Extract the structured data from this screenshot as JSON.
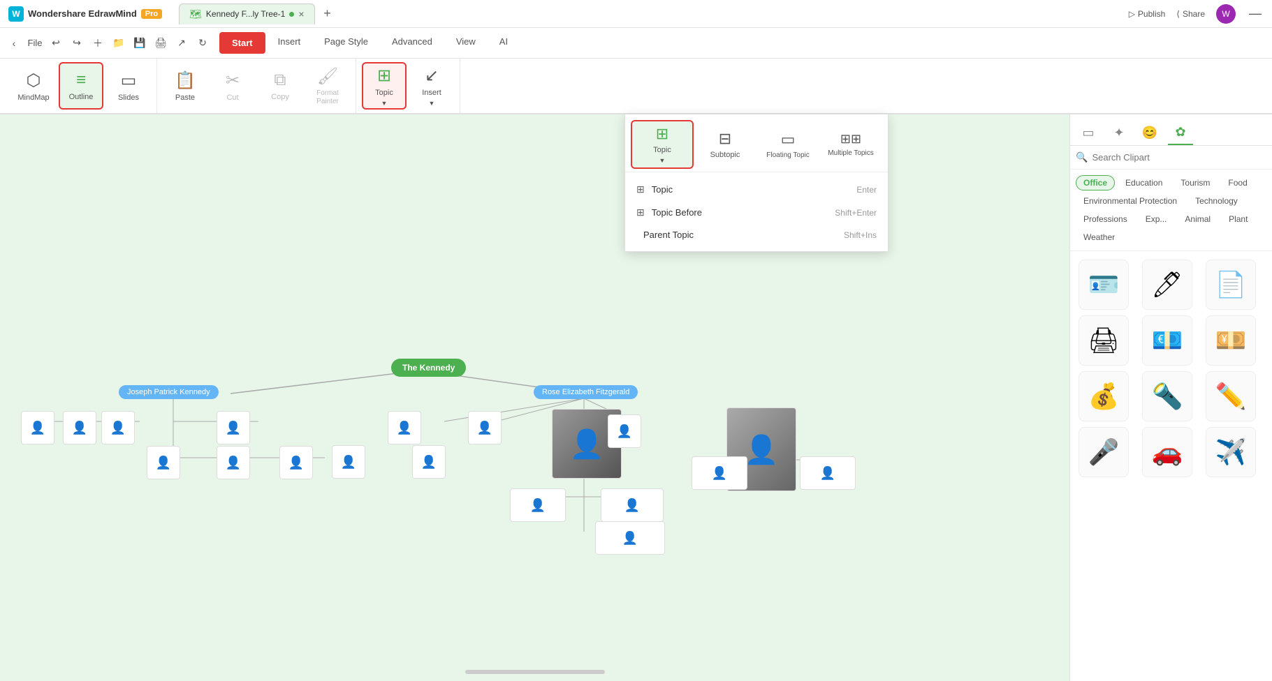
{
  "app": {
    "name": "Wondershare EdrawMind",
    "pro_label": "Pro",
    "tab_title": "Kennedy F...ly Tree-1",
    "avatar_initials": "W"
  },
  "title_bar": {
    "publish_label": "Publish",
    "share_label": "Share"
  },
  "nav": {
    "file_label": "File",
    "back_tooltip": "Back",
    "forward_tooltip": "Forward",
    "new_tooltip": "New",
    "open_tooltip": "Open",
    "save_tooltip": "Save",
    "print_tooltip": "Print",
    "export_tooltip": "Export",
    "recover_tooltip": "Recover"
  },
  "menu_tabs": [
    {
      "id": "start",
      "label": "Start",
      "active": true
    },
    {
      "id": "insert",
      "label": "Insert",
      "active": false
    },
    {
      "id": "page_style",
      "label": "Page Style",
      "active": false
    },
    {
      "id": "advanced",
      "label": "Advanced",
      "active": false
    },
    {
      "id": "view",
      "label": "View",
      "active": false
    },
    {
      "id": "ai",
      "label": "AI",
      "active": false
    }
  ],
  "toolbar": {
    "view_modes": [
      {
        "id": "mindmap",
        "label": "MindMap",
        "icon": "⬡",
        "active": false
      },
      {
        "id": "outline",
        "label": "Outline",
        "icon": "≡",
        "active": true
      },
      {
        "id": "slides",
        "label": "Slides",
        "icon": "▭",
        "active": false
      }
    ],
    "edit_tools": [
      {
        "id": "paste",
        "label": "Paste",
        "icon": "📋",
        "disabled": false
      },
      {
        "id": "cut",
        "label": "Cut",
        "icon": "✂",
        "disabled": true
      },
      {
        "id": "copy",
        "label": "Copy",
        "icon": "⧉",
        "disabled": true
      },
      {
        "id": "format_painter",
        "label": "Format Painter",
        "icon": "🖌",
        "disabled": true
      }
    ],
    "insert_tools": [
      {
        "id": "topic",
        "label": "Topic",
        "icon": "⊞",
        "active": true,
        "has_dropdown": true
      },
      {
        "id": "insert",
        "label": "Insert",
        "icon": "↙",
        "has_dropdown": true
      }
    ]
  },
  "topic_dropdown": {
    "items": [
      {
        "id": "topic",
        "label": "Topic",
        "icon": "⊞",
        "active": true
      },
      {
        "id": "subtopic",
        "label": "Subtopic",
        "icon": "⊟",
        "active": false
      },
      {
        "id": "floating_topic",
        "label": "Floating Topic",
        "icon": "▭",
        "active": false
      },
      {
        "id": "multiple_topics",
        "label": "Multiple Topics",
        "icon": "⊞⊞",
        "active": false
      }
    ],
    "submenu": [
      {
        "id": "topic",
        "label": "Topic",
        "shortcut": "Enter",
        "icon": "⊞"
      },
      {
        "id": "topic_before",
        "label": "Topic Before",
        "shortcut": "Shift+Enter",
        "icon": "⊞"
      },
      {
        "id": "parent_topic",
        "label": "Parent Topic",
        "shortcut": "Shift+Ins",
        "icon": ""
      }
    ]
  },
  "mindmap": {
    "central_node": "The Kennedy",
    "left_parent": "Joseph Patrick Kennedy",
    "right_parent": "Rose Elizabeth Fitzgerald"
  },
  "right_panel": {
    "search_placeholder": "Search Clipart",
    "categories": [
      {
        "id": "office",
        "label": "Office",
        "active": true
      },
      {
        "id": "education",
        "label": "Education",
        "active": false
      },
      {
        "id": "tourism",
        "label": "Tourism",
        "active": false
      },
      {
        "id": "food",
        "label": "Food",
        "active": false
      },
      {
        "id": "environmental_protection",
        "label": "Environmental Protection",
        "active": false
      },
      {
        "id": "technology",
        "label": "Technology",
        "active": false
      },
      {
        "id": "professions",
        "label": "Professions",
        "active": false
      },
      {
        "id": "exp",
        "label": "Exp...",
        "active": false
      },
      {
        "id": "animal",
        "label": "Animal",
        "active": false
      },
      {
        "id": "plant",
        "label": "Plant",
        "active": false
      },
      {
        "id": "weather",
        "label": "Weather",
        "active": false
      }
    ],
    "clipart_icons": [
      "🪪",
      "🖊",
      "📄",
      "🖨",
      "💶",
      "💴",
      "💰",
      "🔦",
      "✏️",
      "🎤",
      "🚗",
      "✈️"
    ]
  }
}
